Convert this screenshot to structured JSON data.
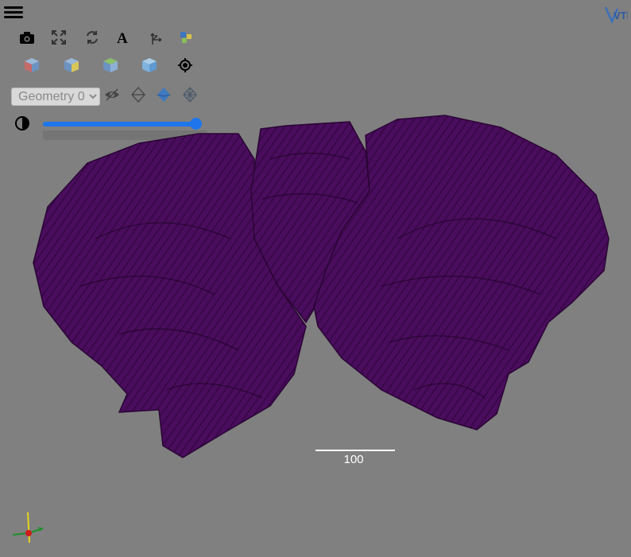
{
  "toolbar": {
    "row1": [
      {
        "icon": "camera-icon",
        "title": "screenshot"
      },
      {
        "icon": "expand-icon",
        "title": "reset-camera"
      },
      {
        "icon": "rotate-icon",
        "title": "rotate"
      },
      {
        "icon": "text-a-icon",
        "title": "text"
      },
      {
        "icon": "axes-icon",
        "title": "axes"
      },
      {
        "icon": "color-cubes-icon",
        "title": "colors"
      }
    ],
    "row2": [
      {
        "icon": "cube-red-icon"
      },
      {
        "icon": "cube-yellow-icon"
      },
      {
        "icon": "cube-green-icon"
      },
      {
        "icon": "cube-blue-icon"
      },
      {
        "icon": "crosshair-icon"
      }
    ],
    "geometry_select": {
      "selected": "Geometry 0",
      "options": [
        "Geometry 0"
      ]
    },
    "row3_icons": [
      "eye-hidden-icon",
      "diamond-outline-icon",
      "diamond-filled-icon",
      "diamond-wire-icon"
    ],
    "opacity_icon": "contrast-icon",
    "opacity_value": 1.0
  },
  "scale_bar": {
    "label": "100"
  },
  "logo": {
    "text": "VTK"
  },
  "colors": {
    "background": "#808080",
    "mesh": "#4a0d5e",
    "mesh_dark": "#2a0535",
    "accent": "#1e76ea"
  }
}
